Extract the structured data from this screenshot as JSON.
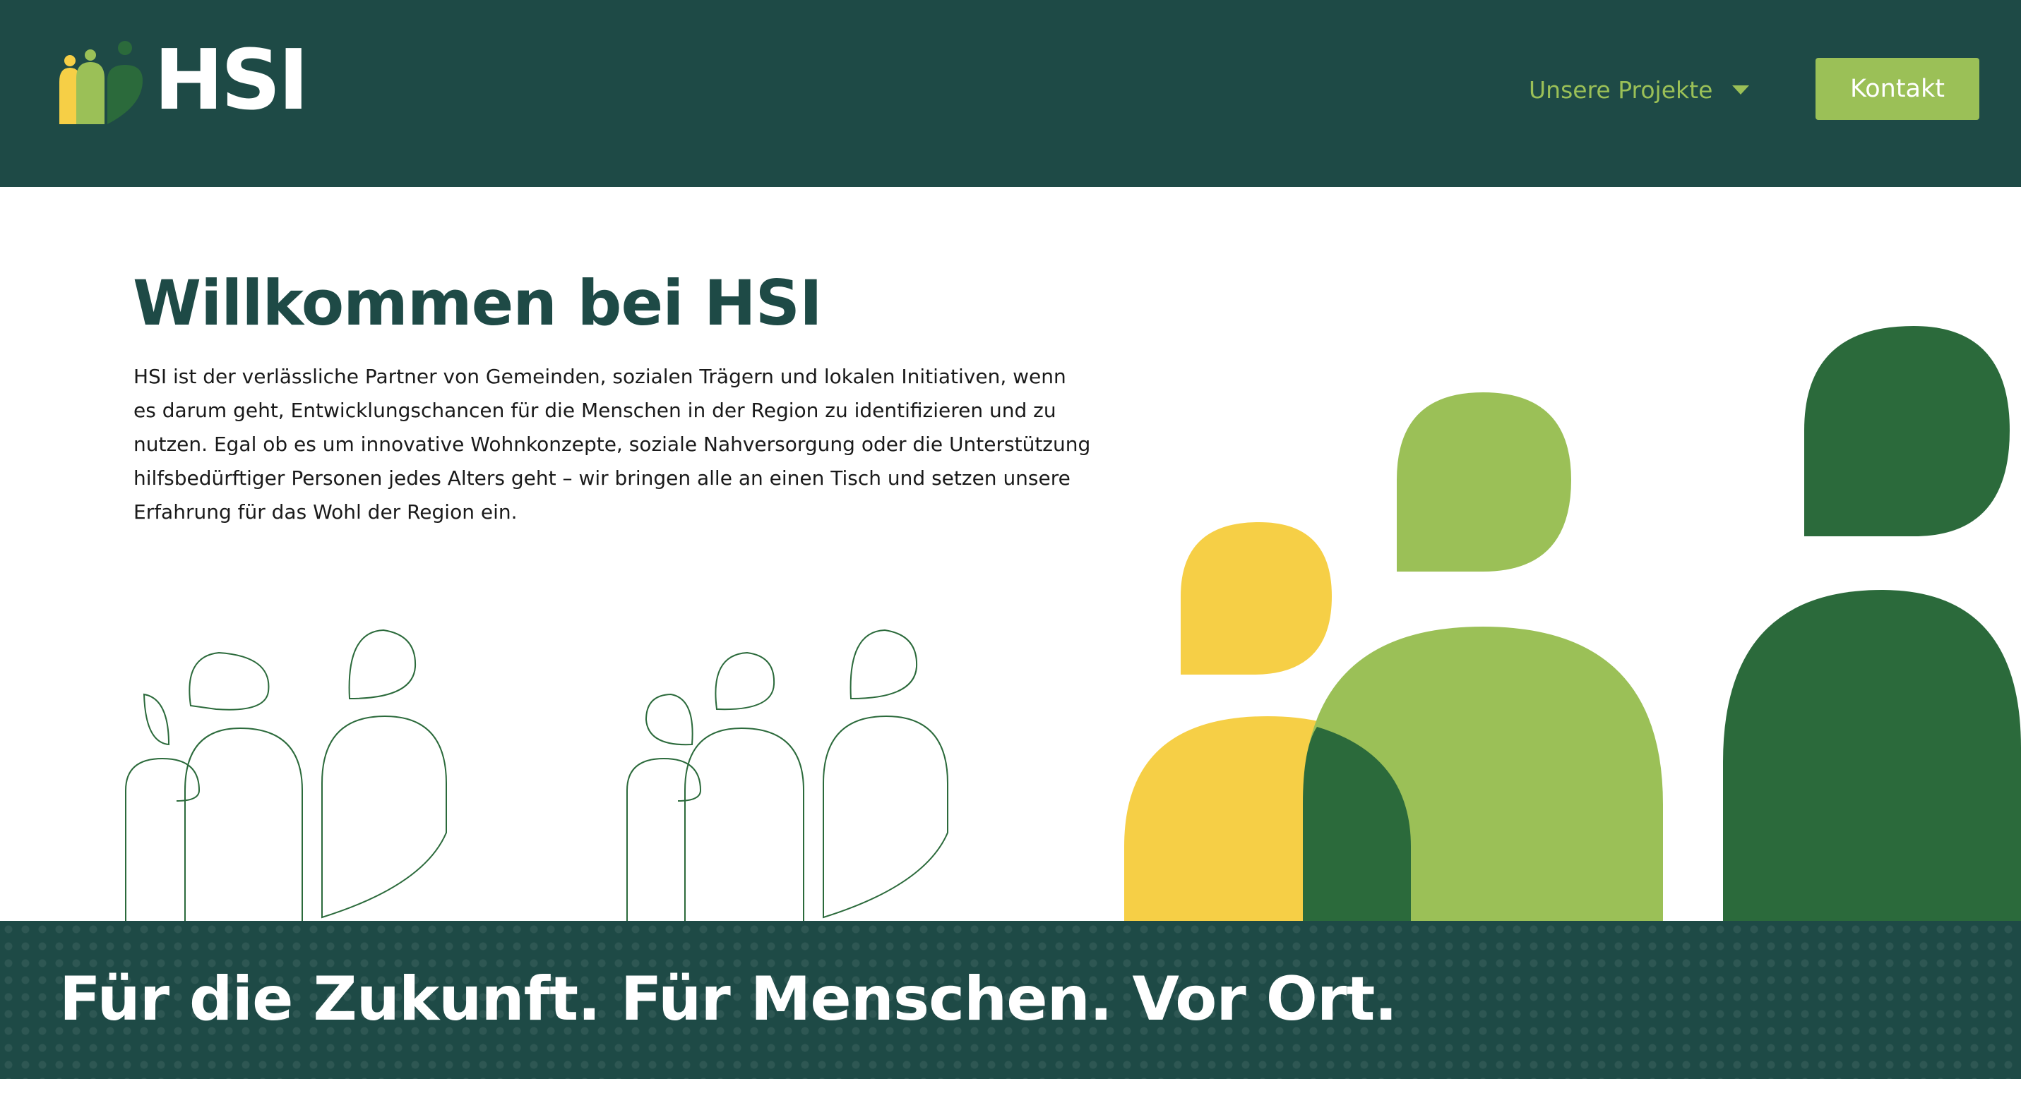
{
  "header": {
    "logo_text": "HSI",
    "nav": {
      "projects_label": "Unsere Projekte"
    },
    "contact_label": "Kontakt"
  },
  "main": {
    "title": "Willkommen bei HSI",
    "intro": "HSI ist der verlässliche Partner von Gemeinden, sozialen Trägern und lokalen Initiativen, wenn es darum geht, Entwicklungschancen für die Menschen in der Region zu identifizieren und zu nutzen. Egal ob es um innovative Wohnkonzepte, soziale Nahversorgung oder die Unterstützung hilfsbedürftiger Personen jedes Alters geht – wir bringen alle an einen Tisch und setzen unsere Erfahrung für das Wohl der Region ein."
  },
  "banner": {
    "tagline": "Für die Zukunft. Für Menschen. Vor Ort."
  },
  "colors": {
    "dark_teal": "#1e4a46",
    "light_green": "#9bc057",
    "dark_green": "#2b6a3b",
    "yellow": "#f6cf46",
    "white": "#ffffff"
  },
  "icons": {
    "caret": "chevron-down-icon",
    "logo": "people-logo-icon"
  }
}
